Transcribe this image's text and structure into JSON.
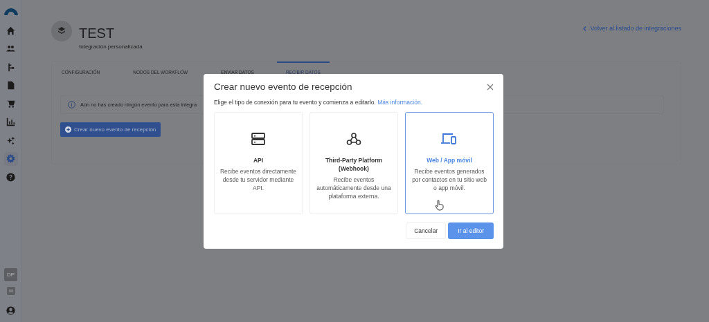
{
  "sidebar": {
    "items": [
      {
        "selected": false
      },
      {
        "selected": false
      },
      {
        "selected": false
      },
      {
        "selected": false
      },
      {
        "selected": false
      },
      {
        "selected": false
      },
      {
        "selected": false
      },
      {
        "selected": true
      },
      {
        "selected": false
      }
    ],
    "account_badge": "DP"
  },
  "back_link": "Volver al listado de integraciones",
  "header": {
    "title": "TEST",
    "subtitle": "Integración personalizada"
  },
  "tabs": [
    {
      "label": "CONFIGURACIÓN",
      "selected": false
    },
    {
      "label": "NODOS DEL WORKFLOW",
      "selected": false
    },
    {
      "label": "ENVIAR DATOS",
      "selected": false
    },
    {
      "label": "RECIBIR DATOS",
      "selected": true
    }
  ],
  "notice": "Aún no has creado ningún evento para esta integra",
  "create_button": "Crear nuevo evento de recepción",
  "dialog": {
    "title": "Crear nuevo evento de recepción",
    "intro": "Elige el tipo de conexión para tu evento y comienza a editarlo.",
    "intro_link": "Más información.",
    "options": [
      {
        "title": "API",
        "description": "Recibe eventos directamente desde tu servidor mediante API.",
        "selected": false
      },
      {
        "title": "Third-Party Platform (Webhook)",
        "description": "Recibe eventos automáticamente desde una plataforma externa.",
        "selected": false
      },
      {
        "title": "Web / App móvil",
        "description": "Recibe eventos generados por contactos en tu sitio web o app móvil.",
        "selected": true
      }
    ],
    "buttons": [
      "Cancelar",
      "Ir al editor"
    ]
  }
}
